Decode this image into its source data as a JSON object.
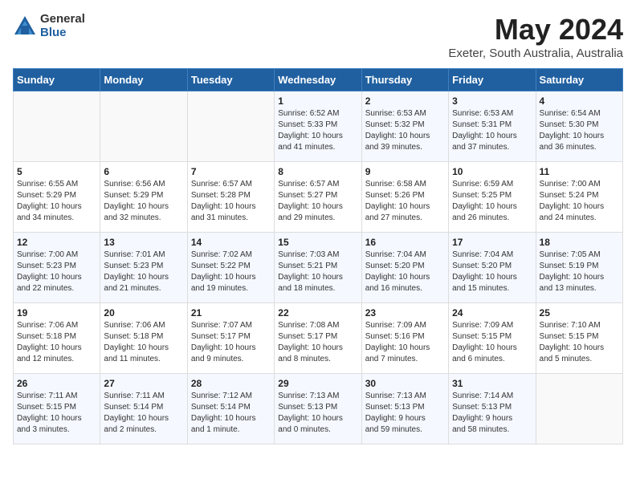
{
  "logo": {
    "general": "General",
    "blue": "Blue"
  },
  "title": "May 2024",
  "subtitle": "Exeter, South Australia, Australia",
  "days": [
    "Sunday",
    "Monday",
    "Tuesday",
    "Wednesday",
    "Thursday",
    "Friday",
    "Saturday"
  ],
  "weeks": [
    [
      {
        "day": "",
        "content": ""
      },
      {
        "day": "",
        "content": ""
      },
      {
        "day": "",
        "content": ""
      },
      {
        "day": "1",
        "content": "Sunrise: 6:52 AM\nSunset: 5:33 PM\nDaylight: 10 hours\nand 41 minutes."
      },
      {
        "day": "2",
        "content": "Sunrise: 6:53 AM\nSunset: 5:32 PM\nDaylight: 10 hours\nand 39 minutes."
      },
      {
        "day": "3",
        "content": "Sunrise: 6:53 AM\nSunset: 5:31 PM\nDaylight: 10 hours\nand 37 minutes."
      },
      {
        "day": "4",
        "content": "Sunrise: 6:54 AM\nSunset: 5:30 PM\nDaylight: 10 hours\nand 36 minutes."
      }
    ],
    [
      {
        "day": "5",
        "content": "Sunrise: 6:55 AM\nSunset: 5:29 PM\nDaylight: 10 hours\nand 34 minutes."
      },
      {
        "day": "6",
        "content": "Sunrise: 6:56 AM\nSunset: 5:29 PM\nDaylight: 10 hours\nand 32 minutes."
      },
      {
        "day": "7",
        "content": "Sunrise: 6:57 AM\nSunset: 5:28 PM\nDaylight: 10 hours\nand 31 minutes."
      },
      {
        "day": "8",
        "content": "Sunrise: 6:57 AM\nSunset: 5:27 PM\nDaylight: 10 hours\nand 29 minutes."
      },
      {
        "day": "9",
        "content": "Sunrise: 6:58 AM\nSunset: 5:26 PM\nDaylight: 10 hours\nand 27 minutes."
      },
      {
        "day": "10",
        "content": "Sunrise: 6:59 AM\nSunset: 5:25 PM\nDaylight: 10 hours\nand 26 minutes."
      },
      {
        "day": "11",
        "content": "Sunrise: 7:00 AM\nSunset: 5:24 PM\nDaylight: 10 hours\nand 24 minutes."
      }
    ],
    [
      {
        "day": "12",
        "content": "Sunrise: 7:00 AM\nSunset: 5:23 PM\nDaylight: 10 hours\nand 22 minutes."
      },
      {
        "day": "13",
        "content": "Sunrise: 7:01 AM\nSunset: 5:23 PM\nDaylight: 10 hours\nand 21 minutes."
      },
      {
        "day": "14",
        "content": "Sunrise: 7:02 AM\nSunset: 5:22 PM\nDaylight: 10 hours\nand 19 minutes."
      },
      {
        "day": "15",
        "content": "Sunrise: 7:03 AM\nSunset: 5:21 PM\nDaylight: 10 hours\nand 18 minutes."
      },
      {
        "day": "16",
        "content": "Sunrise: 7:04 AM\nSunset: 5:20 PM\nDaylight: 10 hours\nand 16 minutes."
      },
      {
        "day": "17",
        "content": "Sunrise: 7:04 AM\nSunset: 5:20 PM\nDaylight: 10 hours\nand 15 minutes."
      },
      {
        "day": "18",
        "content": "Sunrise: 7:05 AM\nSunset: 5:19 PM\nDaylight: 10 hours\nand 13 minutes."
      }
    ],
    [
      {
        "day": "19",
        "content": "Sunrise: 7:06 AM\nSunset: 5:18 PM\nDaylight: 10 hours\nand 12 minutes."
      },
      {
        "day": "20",
        "content": "Sunrise: 7:06 AM\nSunset: 5:18 PM\nDaylight: 10 hours\nand 11 minutes."
      },
      {
        "day": "21",
        "content": "Sunrise: 7:07 AM\nSunset: 5:17 PM\nDaylight: 10 hours\nand 9 minutes."
      },
      {
        "day": "22",
        "content": "Sunrise: 7:08 AM\nSunset: 5:17 PM\nDaylight: 10 hours\nand 8 minutes."
      },
      {
        "day": "23",
        "content": "Sunrise: 7:09 AM\nSunset: 5:16 PM\nDaylight: 10 hours\nand 7 minutes."
      },
      {
        "day": "24",
        "content": "Sunrise: 7:09 AM\nSunset: 5:15 PM\nDaylight: 10 hours\nand 6 minutes."
      },
      {
        "day": "25",
        "content": "Sunrise: 7:10 AM\nSunset: 5:15 PM\nDaylight: 10 hours\nand 5 minutes."
      }
    ],
    [
      {
        "day": "26",
        "content": "Sunrise: 7:11 AM\nSunset: 5:15 PM\nDaylight: 10 hours\nand 3 minutes."
      },
      {
        "day": "27",
        "content": "Sunrise: 7:11 AM\nSunset: 5:14 PM\nDaylight: 10 hours\nand 2 minutes."
      },
      {
        "day": "28",
        "content": "Sunrise: 7:12 AM\nSunset: 5:14 PM\nDaylight: 10 hours\nand 1 minute."
      },
      {
        "day": "29",
        "content": "Sunrise: 7:13 AM\nSunset: 5:13 PM\nDaylight: 10 hours\nand 0 minutes."
      },
      {
        "day": "30",
        "content": "Sunrise: 7:13 AM\nSunset: 5:13 PM\nDaylight: 9 hours\nand 59 minutes."
      },
      {
        "day": "31",
        "content": "Sunrise: 7:14 AM\nSunset: 5:13 PM\nDaylight: 9 hours\nand 58 minutes."
      },
      {
        "day": "",
        "content": ""
      }
    ]
  ]
}
